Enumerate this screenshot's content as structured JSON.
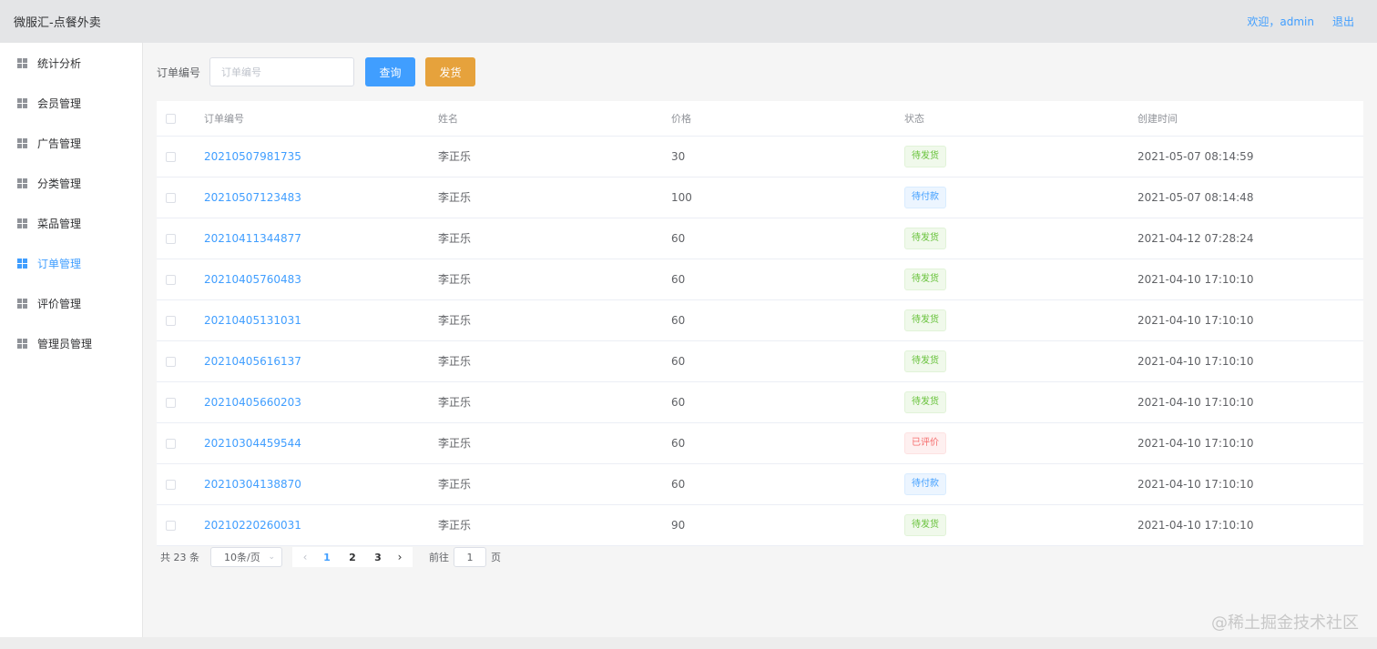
{
  "header": {
    "title": "微服汇-点餐外卖",
    "welcome": "欢迎，admin",
    "logout": "退出"
  },
  "sidebar": {
    "items": [
      {
        "label": "统计分析",
        "name": "stats",
        "active": false
      },
      {
        "label": "会员管理",
        "name": "members",
        "active": false
      },
      {
        "label": "广告管理",
        "name": "ads",
        "active": false
      },
      {
        "label": "分类管理",
        "name": "categories",
        "active": false
      },
      {
        "label": "菜品管理",
        "name": "dishes",
        "active": false
      },
      {
        "label": "订单管理",
        "name": "orders",
        "active": true
      },
      {
        "label": "评价管理",
        "name": "reviews",
        "active": false
      },
      {
        "label": "管理员管理",
        "name": "admins",
        "active": false
      }
    ]
  },
  "toolbar": {
    "label": "订单编号",
    "placeholder": "订单编号",
    "query_label": "查询",
    "ship_label": "发货"
  },
  "table": {
    "headers": {
      "order_no": "订单编号",
      "name": "姓名",
      "price": "价格",
      "status": "状态",
      "created": "创建时间"
    },
    "rows": [
      {
        "order_no": "20210507981735",
        "name": "李正乐",
        "price": "30",
        "status": "待发货",
        "status_type": "success",
        "created": "2021-05-07 08:14:59"
      },
      {
        "order_no": "20210507123483",
        "name": "李正乐",
        "price": "100",
        "status": "待付款",
        "status_type": "info",
        "created": "2021-05-07 08:14:48"
      },
      {
        "order_no": "20210411344877",
        "name": "李正乐",
        "price": "60",
        "status": "待发货",
        "status_type": "success",
        "created": "2021-04-12 07:28:24"
      },
      {
        "order_no": "20210405760483",
        "name": "李正乐",
        "price": "60",
        "status": "待发货",
        "status_type": "success",
        "created": "2021-04-10 17:10:10"
      },
      {
        "order_no": "20210405131031",
        "name": "李正乐",
        "price": "60",
        "status": "待发货",
        "status_type": "success",
        "created": "2021-04-10 17:10:10"
      },
      {
        "order_no": "20210405616137",
        "name": "李正乐",
        "price": "60",
        "status": "待发货",
        "status_type": "success",
        "created": "2021-04-10 17:10:10"
      },
      {
        "order_no": "20210405660203",
        "name": "李正乐",
        "price": "60",
        "status": "待发货",
        "status_type": "success",
        "created": "2021-04-10 17:10:10"
      },
      {
        "order_no": "20210304459544",
        "name": "李正乐",
        "price": "60",
        "status": "已评价",
        "status_type": "danger",
        "created": "2021-04-10 17:10:10"
      },
      {
        "order_no": "20210304138870",
        "name": "李正乐",
        "price": "60",
        "status": "待付款",
        "status_type": "info",
        "created": "2021-04-10 17:10:10"
      },
      {
        "order_no": "20210220260031",
        "name": "李正乐",
        "price": "90",
        "status": "待发货",
        "status_type": "success",
        "created": "2021-04-10 17:10:10"
      }
    ]
  },
  "pagination": {
    "total": "共 23 条",
    "page_size": "10条/页",
    "pages": [
      "1",
      "2",
      "3"
    ],
    "current": "1",
    "goto_label": "前往",
    "goto_value": "1",
    "page_suffix": "页"
  },
  "watermark": "@稀土掘金技术社区",
  "colors": {
    "primary": "#409eff",
    "warning": "#e6a23c",
    "success": "#67c23a",
    "danger": "#f56c6c"
  },
  "icons": {
    "menu": "grid-icon",
    "prev": "chevron-left-icon",
    "next": "chevron-right-icon",
    "select": "chevron-down-icon"
  }
}
